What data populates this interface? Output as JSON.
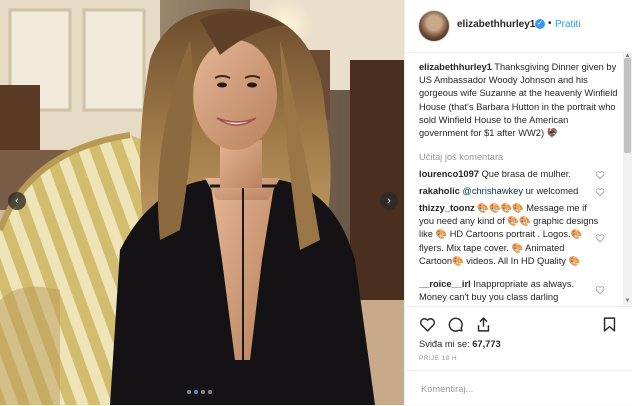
{
  "post": {
    "username": "elizabethhurley1",
    "follow_label": "Pratiti",
    "separator": "•",
    "caption_user": "elizabethhurley1",
    "caption_text": "Thanksgiving Dinner given by US Ambassador Woody Johnson and his gorgeous wife Suzanne at the heavenly Winfield House (that's Barbara Hutton in the portrait who sold Winfield House to the American government for $1 after WW2) 🦃",
    "load_more_label": "Učitaj još komentara",
    "comments": [
      {
        "user": "lourenco1097",
        "text": "Que brasa de mulher."
      },
      {
        "user": "rakaholic",
        "mention": "@chrishawkey",
        "text": " ur welcomed"
      },
      {
        "user": "thizzy_toonz",
        "text": "🎨🎨🎨🎨 Message me if you need any kind of 🎨🎨 graphic designs like 🎨 HD Cartoons portrait . Logos.🎨 flyers.  Mix tape cover. 🎨 Animated Cartoon🎨 videos. All In HD Quality 🎨"
      },
      {
        "user": "__roice__irl",
        "text": "Inappropriate as always. Money can't buy you class darling"
      }
    ],
    "likes_label": "Sviđa mi se:",
    "likes_count": "67,773",
    "timestamp": "PRIJE 18 H",
    "comment_placeholder": "Komentiraj..."
  },
  "carousel": {
    "slide_count": 4,
    "active_index": 1
  },
  "icons": {
    "verified": "verified-badge-icon",
    "heart": "heart-icon",
    "comment": "comment-icon",
    "share": "share-icon",
    "save": "bookmark-icon",
    "prev": "chevron-left-icon",
    "next": "chevron-right-icon"
  },
  "colors": {
    "link": "#3897f0",
    "text": "#262626",
    "muted": "#999999",
    "border": "#efefef"
  }
}
